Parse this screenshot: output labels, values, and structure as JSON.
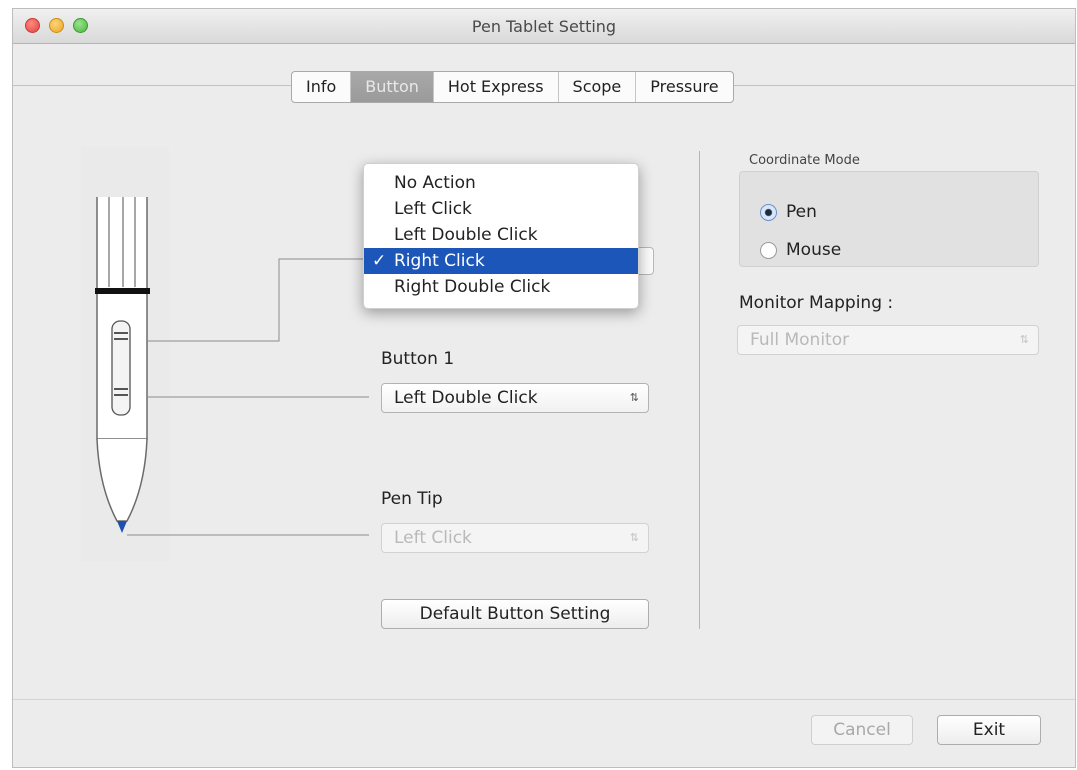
{
  "window": {
    "title": "Pen Tablet Setting"
  },
  "tabs": [
    "Info",
    "Button",
    "Hot Express",
    "Scope",
    "Pressure"
  ],
  "active_tab": "Button",
  "popup": {
    "items": [
      "No Action",
      "Left Click",
      "Left Double Click",
      "Right Click",
      "Right Double Click"
    ],
    "selected": "Right Click",
    "check": "✓"
  },
  "button1": {
    "label": "Button 1",
    "value": "Left Double Click"
  },
  "pen_tip": {
    "label": "Pen Tip",
    "value": "Left Click"
  },
  "default_button": "Default Button Setting",
  "coordinate_mode": {
    "label": "Coordinate Mode",
    "options": [
      "Pen",
      "Mouse"
    ],
    "selected": "Pen"
  },
  "monitor_mapping": {
    "label": "Monitor Mapping :",
    "value": "Full Monitor"
  },
  "footer": {
    "cancel": "Cancel",
    "exit": "Exit"
  },
  "icons": {
    "updown": "⇅",
    "pen": "pen-illustration"
  },
  "colors": {
    "selection": "#1b56b8",
    "pen_tip": "#1f4fb0"
  }
}
